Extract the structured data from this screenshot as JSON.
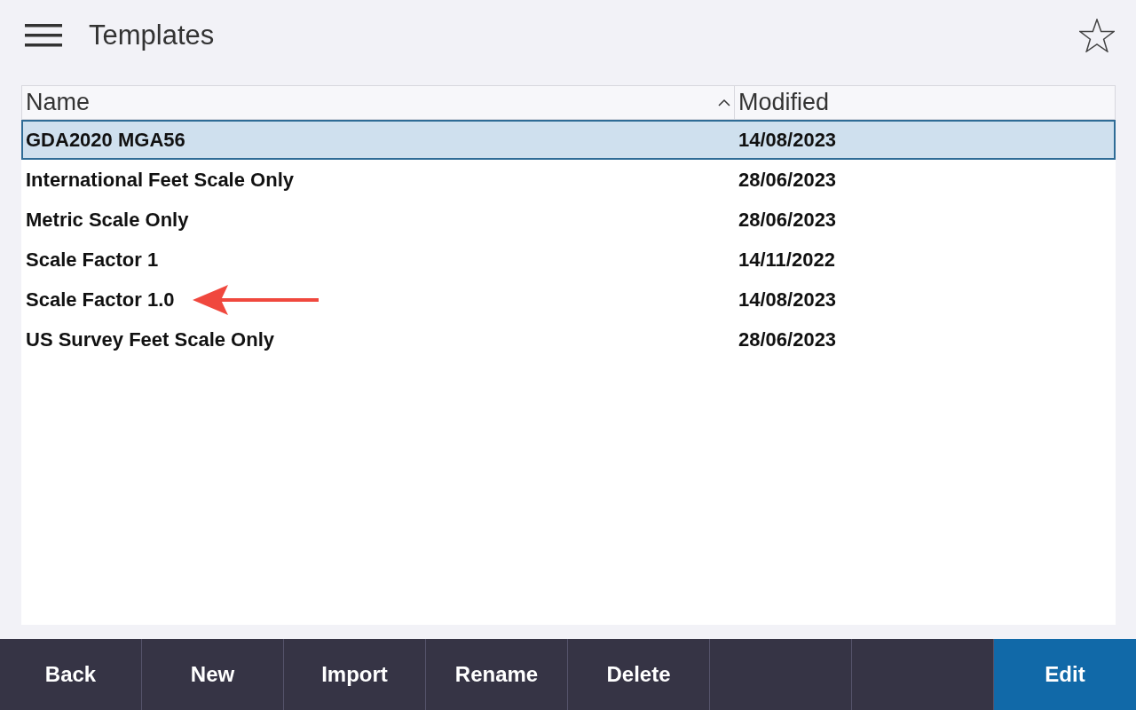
{
  "header": {
    "title": "Templates",
    "favorite": false
  },
  "table": {
    "columns": [
      {
        "label": "Name",
        "sorted_ascending": true
      },
      {
        "label": "Modified",
        "sorted_ascending": false
      }
    ],
    "rows": [
      {
        "name": "GDA2020 MGA56",
        "modified": "14/08/2023",
        "selected": true,
        "pointer_arrow": false
      },
      {
        "name": "International Feet Scale Only",
        "modified": "28/06/2023",
        "selected": false,
        "pointer_arrow": false
      },
      {
        "name": "Metric Scale Only",
        "modified": "28/06/2023",
        "selected": false,
        "pointer_arrow": false
      },
      {
        "name": "Scale Factor 1",
        "modified": "14/11/2022",
        "selected": false,
        "pointer_arrow": false
      },
      {
        "name": "Scale Factor 1.0",
        "modified": "14/08/2023",
        "selected": false,
        "pointer_arrow": true
      },
      {
        "name": "US Survey Feet Scale Only",
        "modified": "28/06/2023",
        "selected": false,
        "pointer_arrow": false
      }
    ]
  },
  "buttons": [
    {
      "kind": "default",
      "label": "Back"
    },
    {
      "kind": "default",
      "label": "New"
    },
    {
      "kind": "default",
      "label": "Import"
    },
    {
      "kind": "default",
      "label": "Rename"
    },
    {
      "kind": "default",
      "label": "Delete"
    },
    {
      "kind": "blank"
    },
    {
      "kind": "blank"
    },
    {
      "kind": "primary",
      "label": "Edit"
    }
  ]
}
